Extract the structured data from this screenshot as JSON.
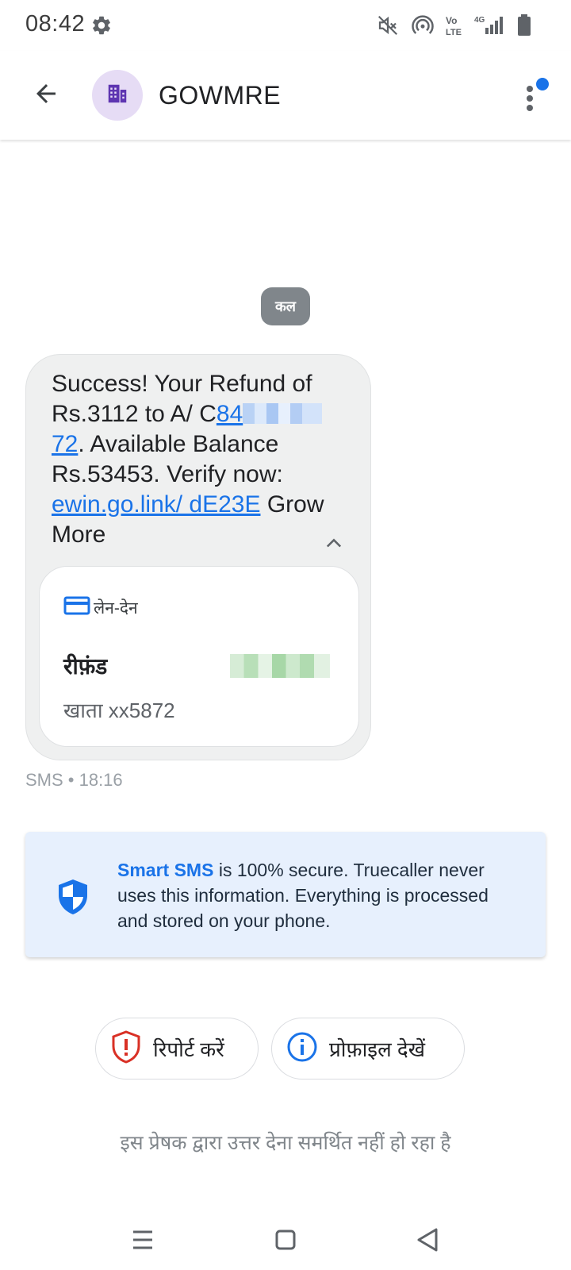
{
  "status_bar": {
    "time": "08:42",
    "icons": [
      "settings-gear",
      "mute",
      "hotspot",
      "volte",
      "4g-signal",
      "battery"
    ],
    "network_label": "Vo LTE",
    "network_type": "4G"
  },
  "app_bar": {
    "sender_name": "GOWMRE",
    "avatar_icon": "business-building",
    "back_icon": "arrow-left",
    "menu_icon": "more-vert",
    "badge_color": "#1a73e8"
  },
  "conversation": {
    "date_chip": "कल",
    "message": {
      "text_part1": "Success! Your Refund of Rs.3112 to A/ C",
      "account_link_start": "84",
      "account_link_end": "72",
      "text_part2": ". Available Balance Rs.53453. Verify now: ",
      "url": "ewin.go.link/ dE23E",
      "text_part3": " Grow More"
    },
    "card": {
      "category_icon": "credit-card",
      "category_label": "लेन-देन",
      "title": "रीफ़ंड",
      "account": "खाता xx5872"
    },
    "meta": "SMS • 18:16"
  },
  "info_box": {
    "highlight": "Smart SMS",
    "text": " is 100% secure. Truecaller never uses this information. Everything is processed and stored on your phone.",
    "icon": "shield",
    "accent_color": "#1a73e8"
  },
  "actions": {
    "report_label": "रिपोर्ट करें",
    "profile_label": "प्रोफ़ाइल देखें"
  },
  "reply_note": "इस प्रेषक द्वारा उत्तर देना समर्थित नहीं हो रहा है",
  "nav_bar": {
    "items": [
      "menu",
      "home",
      "back"
    ]
  }
}
